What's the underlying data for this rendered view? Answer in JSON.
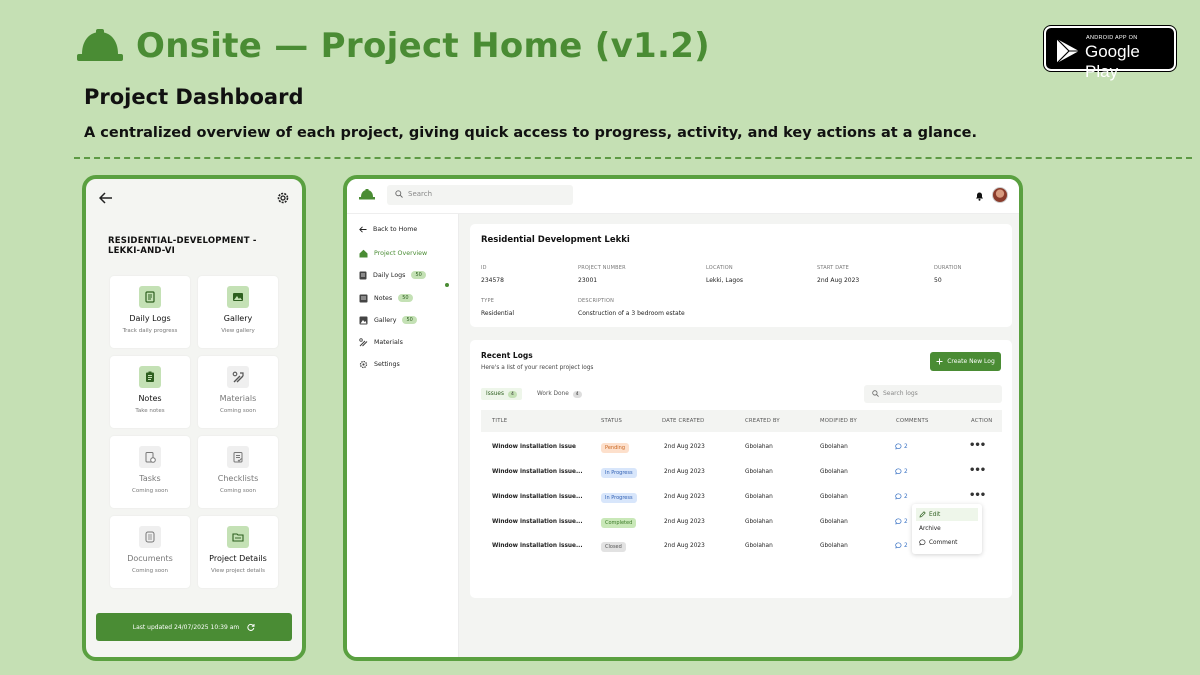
{
  "header": {
    "title": "Onsite — Project Home (v1.2)",
    "subtitle": "Project Dashboard",
    "description": "A centralized overview of each project, giving quick access to progress, activity, and key actions at a glance."
  },
  "store_badge": {
    "small": "ANDROID APP ON",
    "big": "Google Play"
  },
  "colors": {
    "brand": "#4a8c34",
    "background": "#c5e0b4",
    "accent_light": "#c4e1b5"
  },
  "mobile": {
    "project_name": "RESIDENTIAL-DEVELOPMENT -LEKKI-AND-VI",
    "tiles": [
      {
        "title": "Daily Logs",
        "subtitle": "Track daily progress",
        "icon": "daily-logs-icon",
        "enabled": true
      },
      {
        "title": "Gallery",
        "subtitle": "View gallery",
        "icon": "gallery-icon",
        "enabled": true
      },
      {
        "title": "Notes",
        "subtitle": "Take notes",
        "icon": "notes-icon",
        "enabled": true
      },
      {
        "title": "Materials",
        "subtitle": "Coming soon",
        "icon": "tools-icon",
        "enabled": false
      },
      {
        "title": "Tasks",
        "subtitle": "Coming soon",
        "icon": "tasks-icon",
        "enabled": false
      },
      {
        "title": "Checklists",
        "subtitle": "Coming soon",
        "icon": "checklist-icon",
        "enabled": false
      },
      {
        "title": "Documents",
        "subtitle": "Coming soon",
        "icon": "documents-icon",
        "enabled": false
      },
      {
        "title": "Project Details",
        "subtitle": "View project details",
        "icon": "folder-icon",
        "enabled": true
      }
    ],
    "footer": "Last updated 24/07/2025 10:39 am"
  },
  "desktop": {
    "search_placeholder": "Search",
    "sidebar": {
      "back": "Back to Home",
      "items": [
        {
          "label": "Project Overview",
          "count": ""
        },
        {
          "label": "Daily Logs",
          "count": "50"
        },
        {
          "label": "Notes",
          "count": "50"
        },
        {
          "label": "Gallery",
          "count": "50"
        },
        {
          "label": "Materials",
          "count": ""
        },
        {
          "label": "Settings",
          "count": ""
        }
      ]
    },
    "project": {
      "title": "Residential Development Lekki",
      "fields": [
        {
          "label": "ID",
          "value": "234578"
        },
        {
          "label": "PROJECT NUMBER",
          "value": "23001"
        },
        {
          "label": "LOCATION",
          "value": "Lekki, Lagos"
        },
        {
          "label": "START DATE",
          "value": "2nd Aug 2023"
        },
        {
          "label": "DURATION",
          "value": "50"
        },
        {
          "label": "TYPE",
          "value": "Residential"
        },
        {
          "label": "DESCRIPTION",
          "value": "Construction of a 3 bedroom estate"
        }
      ]
    },
    "logs": {
      "title": "Recent Logs",
      "subtitle": "Here's a list of your recent project logs",
      "create_button": "Create New Log",
      "tabs": [
        {
          "label": "Issues",
          "count": "4"
        },
        {
          "label": "Work Done",
          "count": "4"
        }
      ],
      "search_placeholder": "Search logs",
      "columns": [
        "TITLE",
        "STATUS",
        "DATE CREATED",
        "CREATED BY",
        "MODIFIED BY",
        "COMMENTS",
        "ACTION"
      ],
      "rows": [
        {
          "title": "Window installation issue",
          "status": "Pending",
          "date": "2nd Aug 2023",
          "created_by": "Gbolahan",
          "modified_by": "Gbolahan",
          "comments": "2"
        },
        {
          "title": "Window installation issue...",
          "status": "In Progress",
          "date": "2nd Aug 2023",
          "created_by": "Gbolahan",
          "modified_by": "Gbolahan",
          "comments": "2"
        },
        {
          "title": "Window installation issue...",
          "status": "In Progress",
          "date": "2nd Aug 2023",
          "created_by": "Gbolahan",
          "modified_by": "Gbolahan",
          "comments": "2"
        },
        {
          "title": "Window installation issue...",
          "status": "Completed",
          "date": "2nd Aug 2023",
          "created_by": "Gbolahan",
          "modified_by": "Gbolahan",
          "comments": "2"
        },
        {
          "title": "Window installation issue...",
          "status": "Closed",
          "date": "2nd Aug 2023",
          "created_by": "Gbolahan",
          "modified_by": "Gbolahan",
          "comments": "2"
        }
      ],
      "status_colors": {
        "Pending": {
          "bg": "#fde0cc",
          "fg": "#c8651f"
        },
        "In Progress": {
          "bg": "#d8e6fb",
          "fg": "#2f5fb3"
        },
        "Completed": {
          "bg": "#c9e8b8",
          "fg": "#3b7a27"
        },
        "Closed": {
          "bg": "#e2e2e2",
          "fg": "#555555"
        }
      },
      "action_menu": [
        "Edit",
        "Archive",
        "Comment"
      ]
    }
  }
}
